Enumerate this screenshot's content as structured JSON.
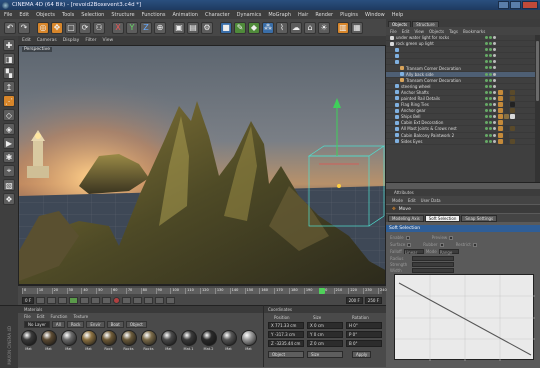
{
  "window": {
    "title": "CINEMA 4D (64 Bit) - [revoid2Boxevent3.c4d *]"
  },
  "menubar": [
    "File",
    "Edit",
    "Objects",
    "Tools",
    "Selection",
    "Structure",
    "Functions",
    "Animation",
    "Character",
    "Dynamics",
    "MoGraph",
    "Hair",
    "Render",
    "Plugins",
    "Window",
    "Help"
  ],
  "viewport": {
    "menu": [
      "Edit",
      "Cameras",
      "Display",
      "Filter",
      "View"
    ],
    "label": "Perspective"
  },
  "timeline": {
    "ticks": [
      "0",
      "10",
      "20",
      "30",
      "40",
      "50",
      "60",
      "70",
      "80",
      "90",
      "100",
      "110",
      "120",
      "130",
      "140",
      "150",
      "160",
      "170",
      "180",
      "190",
      "200",
      "210",
      "220",
      "230",
      "240"
    ],
    "start": "0 F",
    "end": "250 F",
    "current": "200 F"
  },
  "materials": {
    "title": "Materials",
    "menu": [
      "File",
      "Edit",
      "Function",
      "Texture"
    ],
    "tabs": [
      "No Layer",
      "All",
      "Rock",
      "Envir",
      "Boat",
      "Object"
    ],
    "sidebar_text": "MAXON CINEMA 4D",
    "items": [
      {
        "label": "Mat",
        "color": "#3a3a3a"
      },
      {
        "label": "Mat",
        "color": "#5b4a32"
      },
      {
        "label": "Mat",
        "color": "#6a6a6a"
      },
      {
        "label": "Mat",
        "color": "#8a7040"
      },
      {
        "label": "Rock",
        "color": "#6e5a36"
      },
      {
        "label": "Rocks",
        "color": "#6a5a3a"
      },
      {
        "label": "Rocks",
        "color": "#7a6a48"
      },
      {
        "label": "Mat",
        "color": "#4a4a4a"
      },
      {
        "label": "Mat.1",
        "color": "#3a3a3a"
      },
      {
        "label": "Mat.2",
        "color": "#2a2a2a"
      },
      {
        "label": "Mat",
        "color": "#555555"
      },
      {
        "label": "Mat",
        "color": "#9a9a9a"
      }
    ]
  },
  "coordinates": {
    "title": "Coordinates",
    "headers": [
      "Position",
      "Size",
      "Rotation"
    ],
    "rows": [
      {
        "pos": "X  771.33 cm",
        "size": "X  0 cm",
        "rot": "H  0°"
      },
      {
        "pos": "Y  -317.3 cm",
        "size": "Y  0 cm",
        "rot": "P  0°"
      },
      {
        "pos": "Z  -3235.44 cm",
        "size": "Z  0 cm",
        "rot": "B  0°"
      }
    ],
    "mode_object": "Object",
    "mode_size": "Size",
    "apply_label": "Apply"
  },
  "objects": {
    "tabs": [
      "Objects",
      "Structure"
    ],
    "menu": [
      "File",
      "Edit",
      "View",
      "Objects",
      "Tags",
      "Bookmarks"
    ],
    "rows": [
      {
        "name": "under water light for rocks",
        "indent": 0,
        "icon": "#d9d9d9",
        "tags": []
      },
      {
        "name": "rock green up light",
        "indent": 0,
        "icon": "#d9d9d9",
        "tags": []
      },
      {
        "name": "",
        "indent": 1,
        "icon": "#7fb0e0",
        "tags": []
      },
      {
        "name": "",
        "indent": 1,
        "icon": "#7fb0e0",
        "tags": []
      },
      {
        "name": "",
        "indent": 1,
        "icon": "#7fb0e0",
        "tags": []
      },
      {
        "name": "Transom Corner Decoration",
        "indent": 2,
        "icon": "#d9a45a",
        "tags": []
      },
      {
        "name": "Ally back side",
        "indent": 2,
        "icon": "#7fb0e0",
        "tags": []
      },
      {
        "name": "Transom Corner Decoration",
        "indent": 2,
        "icon": "#d9a45a",
        "tags": []
      },
      {
        "name": "steering wheel",
        "indent": 1,
        "icon": "#7fb0e0",
        "tags": []
      },
      {
        "name": "Anchor Shafts",
        "indent": 1,
        "icon": "#7fb0e0",
        "tags": [
          "#c58a3a",
          "#3a3a3a",
          "#5a4a2a"
        ]
      },
      {
        "name": "painted Rail Details",
        "indent": 1,
        "icon": "#7fb0e0",
        "tags": [
          "#c58a3a",
          "#3a3a3a",
          "#5a4a2a"
        ]
      },
      {
        "name": "Flag Ring Ties",
        "indent": 1,
        "icon": "#7fb0e0",
        "tags": [
          "#c58a3a",
          "#3a3a3a",
          "#222222"
        ]
      },
      {
        "name": "Anchor gear",
        "indent": 1,
        "icon": "#7fb0e0",
        "tags": [
          "#c58a3a",
          "#3a3a3a",
          "#5a4a2a"
        ]
      },
      {
        "name": "Ships Bell",
        "indent": 1,
        "icon": "#7fb0e0",
        "tags": [
          "#c58a3a",
          "#8a7040",
          "#d9d9d9"
        ]
      },
      {
        "name": "Cabin Ext Decoration",
        "indent": 1,
        "icon": "#7fb0e0",
        "tags": [
          "#c58a3a"
        ]
      },
      {
        "name": "All Mast Joints & Crows nest",
        "indent": 1,
        "icon": "#7fb0e0",
        "tags": [
          "#c58a3a",
          "#3a3a3a",
          "#5a4a2a"
        ]
      },
      {
        "name": "Cabin Balcony Paintwork 2",
        "indent": 1,
        "icon": "#7fb0e0",
        "tags": [
          "#c58a3a",
          "#3a3a3a"
        ]
      },
      {
        "name": "Sides Eyes",
        "indent": 1,
        "icon": "#7fb0e0",
        "tags": [
          "#c58a3a",
          "#3a3a3a",
          "#5a4a2a"
        ]
      }
    ]
  },
  "attributes": {
    "title": "Attributes",
    "menu": [
      "Mode",
      "Edit",
      "User Data"
    ],
    "object_label": "Move",
    "tabs": [
      "Modeling Axis",
      "Soft Selection",
      "Snap Settings"
    ],
    "active_tab": 1,
    "section": "Soft Selection",
    "rows": [
      {
        "a": "Enable",
        "b": "Preview"
      },
      {
        "a": "Surface",
        "b": "Rubber",
        "c": "Restrict"
      },
      {
        "a": "Falloff",
        "b": "Linear",
        "c": "Mode",
        "d": "Range"
      },
      {
        "a": "Radius"
      },
      {
        "a": "Strength"
      },
      {
        "a": "Width"
      }
    ]
  }
}
